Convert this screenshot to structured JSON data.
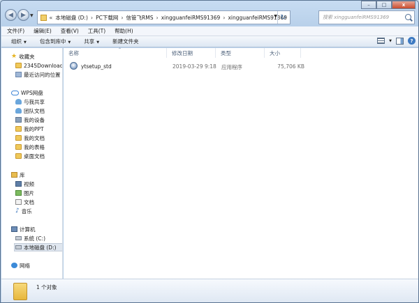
{
  "address": {
    "overflow": "«",
    "crumbs": [
      "本地磁盘 (D:)",
      "PC下载网",
      "信管飞RMS",
      "xingguanfeiRMS91369",
      "xingguanfeiRMS91369"
    ]
  },
  "search": {
    "placeholder": "搜索 xingguanfeiRMS91369"
  },
  "window_controls": {
    "minimize": "–",
    "maximize": "□",
    "close": "x"
  },
  "menu": [
    "文件(F)",
    "编辑(E)",
    "查看(V)",
    "工具(T)",
    "帮助(H)"
  ],
  "toolbar": {
    "organize": "组织",
    "include_library": "包含到库中",
    "share": "共享",
    "new_folder": "新建文件夹"
  },
  "nav": {
    "favorites": "收藏夹",
    "downloads": "2345Downloads",
    "recent": "最近访问的位置",
    "wps": "WPS网盘",
    "shared_with_me": "与我共享",
    "team_docs": "团队文档",
    "my_devices": "我的设备",
    "my_ppt": "我的PPT",
    "my_docs": "我的文档",
    "my_sheets": "我的表格",
    "desktop_docs": "桌面文档",
    "library": "库",
    "videos": "视频",
    "pictures": "图片",
    "documents": "文档",
    "music": "音乐",
    "computer": "计算机",
    "drive_c": "系统 (C:)",
    "drive_d": "本地磁盘 (D:)",
    "network": "网络"
  },
  "columns": {
    "name": "名称",
    "date": "修改日期",
    "type": "类型",
    "size": "大小"
  },
  "files": [
    {
      "name": "ytsetup_std",
      "date": "2019-03-29 9:18",
      "type": "应用程序",
      "size": "75,706 KB"
    }
  ],
  "status": {
    "count": "1 个对象"
  }
}
